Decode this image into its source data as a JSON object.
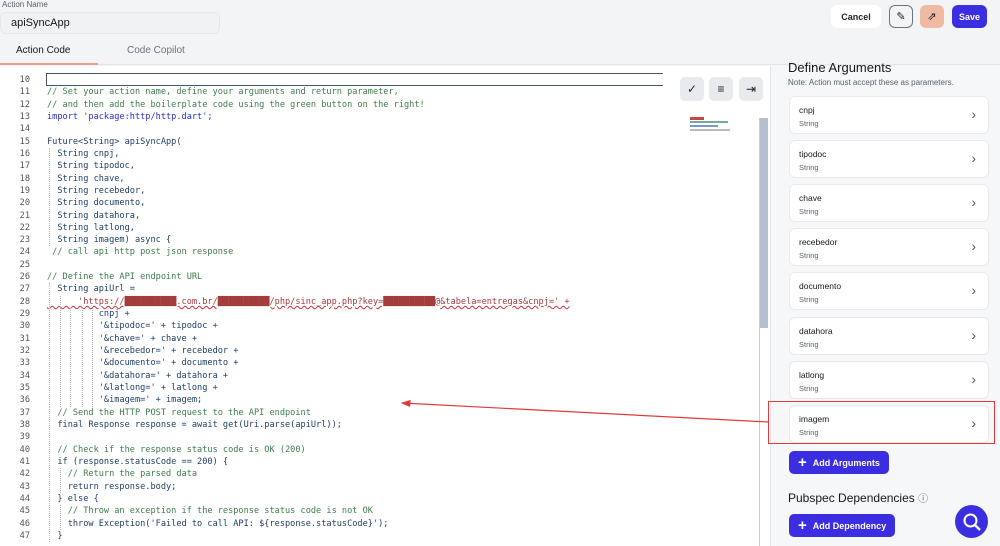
{
  "header": {
    "action_name_label": "Action Name",
    "action_name_value": "apiSyncApp",
    "cancel_label": "Cancel",
    "save_label": "Save"
  },
  "tabs": [
    {
      "label": "Action Code"
    },
    {
      "label": "Code Copilot"
    }
  ],
  "editor": {
    "lines": [
      {
        "n": "10",
        "t": "",
        "k": "blank"
      },
      {
        "n": "11",
        "t": "// Set your action name, define your arguments and return parameter,",
        "k": "com"
      },
      {
        "n": "12",
        "t": "// and then add the boilerplate code using the green button on the right!",
        "k": "com"
      },
      {
        "n": "13",
        "t": "import 'package:http/http.dart';",
        "k": "import"
      },
      {
        "n": "14",
        "t": "",
        "k": "blank"
      },
      {
        "n": "15",
        "t": "Future<String> apiSyncApp(",
        "k": "code"
      },
      {
        "n": "16",
        "t": "  String cnpj,",
        "k": "code"
      },
      {
        "n": "17",
        "t": "  String tipodoc,",
        "k": "code"
      },
      {
        "n": "18",
        "t": "  String chave,",
        "k": "code"
      },
      {
        "n": "19",
        "t": "  String recebedor,",
        "k": "code"
      },
      {
        "n": "20",
        "t": "  String documento,",
        "k": "code"
      },
      {
        "n": "21",
        "t": "  String datahora,",
        "k": "code"
      },
      {
        "n": "22",
        "t": "  String latlong,",
        "k": "code"
      },
      {
        "n": "23",
        "t": "  String imagem) async {",
        "k": "code"
      },
      {
        "n": "24",
        "t": " // call api http post json response",
        "k": "com"
      },
      {
        "n": "25",
        "t": "",
        "k": "blank"
      },
      {
        "n": "26",
        "t": "// Define the API endpoint URL",
        "k": "com"
      },
      {
        "n": "27",
        "t": "  String apiUrl =",
        "k": "code"
      },
      {
        "n": "28",
        "t": "      'https://██████████.com.br/██████████/php/sinc_app.php?key=██████████@&tabela=entregas&cnpj=' +",
        "k": "url"
      },
      {
        "n": "29",
        "t": "          cnpj +",
        "k": "code"
      },
      {
        "n": "30",
        "t": "          '&tipodoc=' + tipodoc +",
        "k": "code"
      },
      {
        "n": "31",
        "t": "          '&chave=' + chave +",
        "k": "code"
      },
      {
        "n": "32",
        "t": "          '&recebedor=' + recebedor +",
        "k": "code"
      },
      {
        "n": "33",
        "t": "          '&documento=' + documento +",
        "k": "code"
      },
      {
        "n": "34",
        "t": "          '&datahora=' + datahora +",
        "k": "code"
      },
      {
        "n": "35",
        "t": "          '&latlong=' + latlong +",
        "k": "code"
      },
      {
        "n": "36",
        "t": "          '&imagem=' + imagem;",
        "k": "code"
      },
      {
        "n": "37",
        "t": "  // Send the HTTP POST request to the API endpoint",
        "k": "com"
      },
      {
        "n": "38",
        "t": "  final Response response = await get(Uri.parse(apiUrl));",
        "k": "code"
      },
      {
        "n": "39",
        "t": "",
        "k": "blank"
      },
      {
        "n": "40",
        "t": "  // Check if the response status code is OK (200)",
        "k": "com"
      },
      {
        "n": "41",
        "t": "  if (response.statusCode == 200) {",
        "k": "code"
      },
      {
        "n": "42",
        "t": "    // Return the parsed data",
        "k": "com"
      },
      {
        "n": "43",
        "t": "    return response.body;",
        "k": "code"
      },
      {
        "n": "44",
        "t": "  } else {",
        "k": "code"
      },
      {
        "n": "45",
        "t": "    // Throw an exception if the response status code is not OK",
        "k": "com"
      },
      {
        "n": "46",
        "t": "    throw Exception('Failed to call API: ${response.statusCode}');",
        "k": "code"
      },
      {
        "n": "47",
        "t": "  }",
        "k": "code"
      }
    ]
  },
  "panel": {
    "title": "Define Arguments",
    "note": "Note: Action must accept these as parameters.",
    "arguments": [
      {
        "name": "cnpj",
        "type": "String"
      },
      {
        "name": "tipodoc",
        "type": "String"
      },
      {
        "name": "chave",
        "type": "String"
      },
      {
        "name": "recebedor",
        "type": "String"
      },
      {
        "name": "documento",
        "type": "String"
      },
      {
        "name": "datahora",
        "type": "String"
      },
      {
        "name": "latlong",
        "type": "String"
      },
      {
        "name": "imagem",
        "type": "String"
      }
    ],
    "add_arguments_label": "Add Arguments",
    "dependencies_title": "Pubspec Dependencies",
    "add_dependency_label": "Add Dependency"
  },
  "colors": {
    "accent": "#3b2ee0",
    "highlight": "#e03a3a"
  }
}
